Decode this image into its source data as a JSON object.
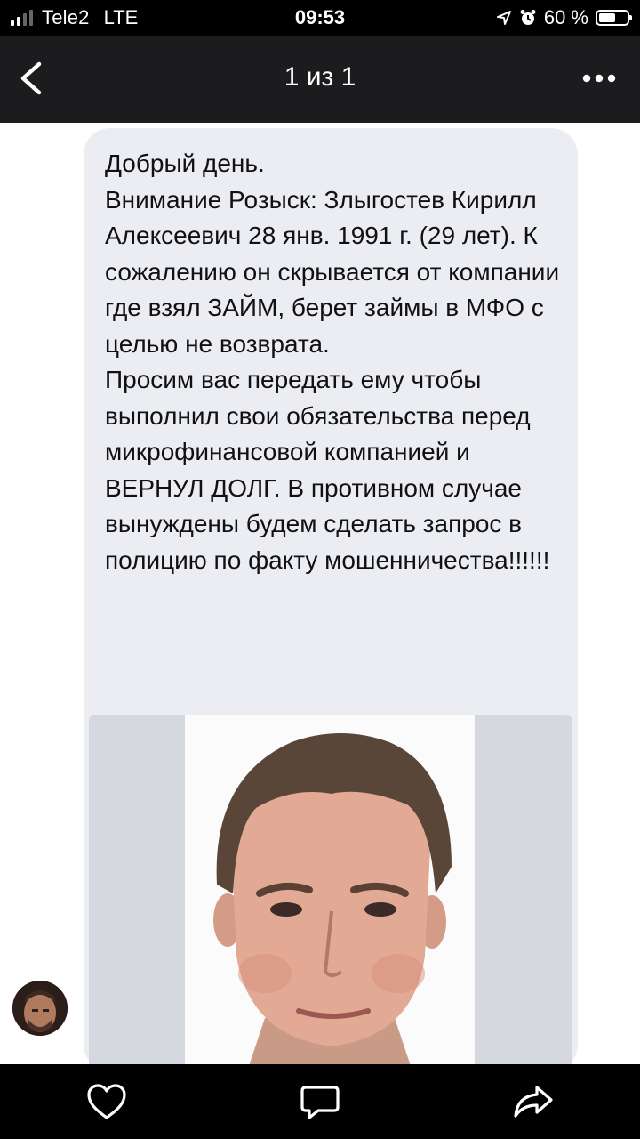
{
  "status_bar": {
    "carrier": "Tele2",
    "network": "LTE",
    "time": "09:53",
    "battery_text": "60 %",
    "battery_level": 0.6
  },
  "header": {
    "title": "1 из 1",
    "back_icon": "chevron-left-icon",
    "more_icon": "more-horizontal-icon"
  },
  "message": {
    "text": "Добрый день.\nВнимание Розыск: Злыгостев Кирилл Алексеевич 28 янв. 1991 г. (29 лет). К сожалению он скрывается от компании где взял ЗАЙМ, берет займы в МФО с целью не возврата.\nПросим вас передать ему чтобы выполнил свои обязательства перед микрофинансовой компанией и ВЕРНУЛ ДОЛГ. В противном случае вынуждены будем сделать запрос в полицию по факту мошенничества!!!!!!"
  },
  "toolbar": {
    "like_icon": "heart-icon",
    "comment_icon": "comment-icon",
    "share_icon": "share-icon"
  },
  "colors": {
    "header_bg": "#1c1c1e",
    "bubble_bg": "#ecedf2",
    "photo_side_bg": "#d6d8e0"
  }
}
